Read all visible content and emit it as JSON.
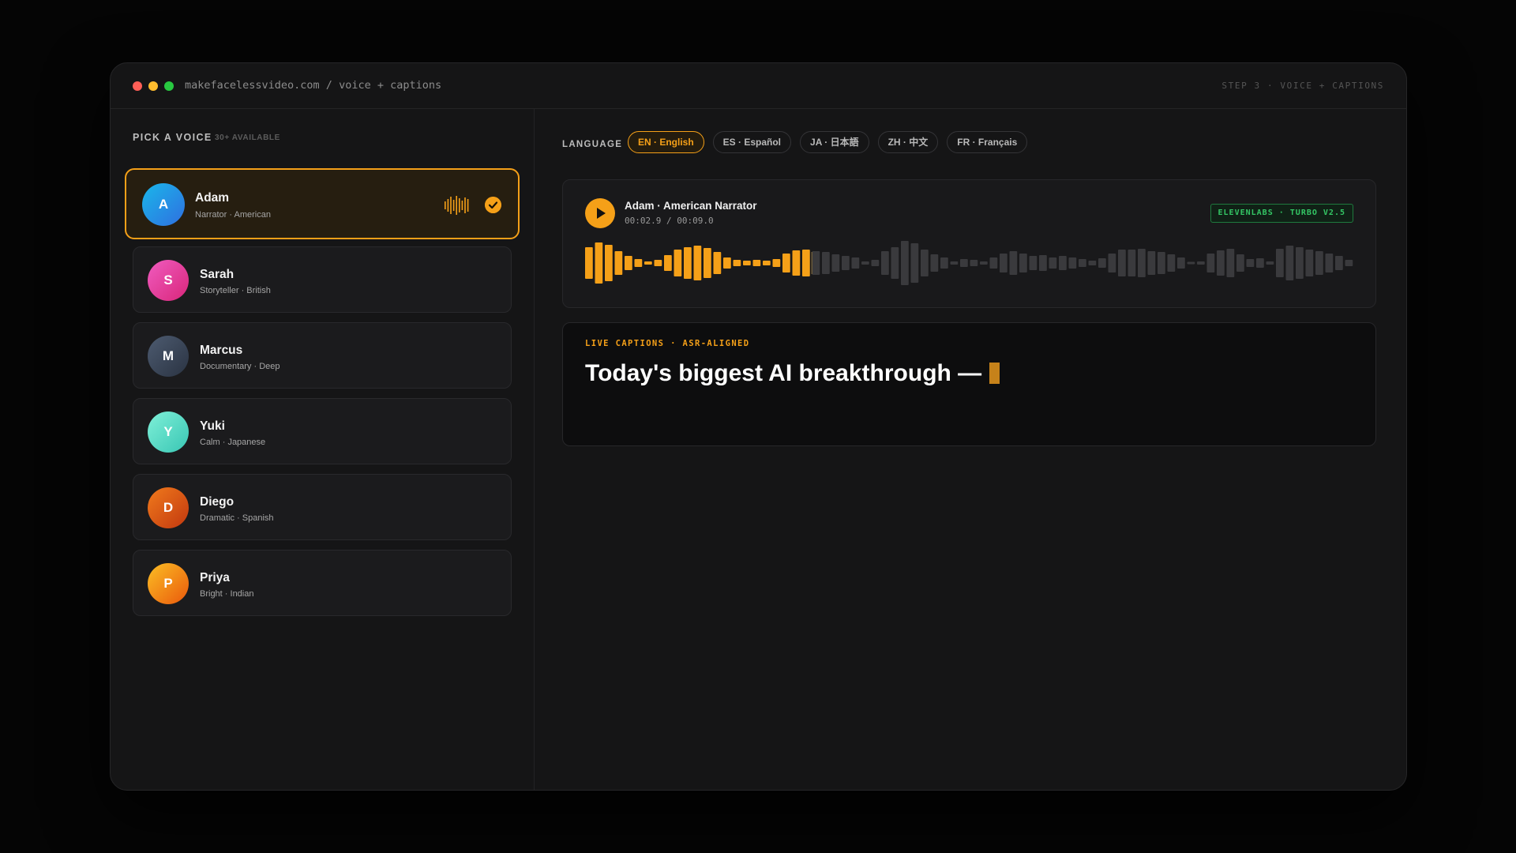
{
  "window": {
    "url": "makefacelessvideo.com / voice + captions",
    "step": "STEP 3 · VOICE + CAPTIONS"
  },
  "voices": {
    "title": "PICK A VOICE",
    "subtitle": "30+ AVAILABLE",
    "items": [
      {
        "initial": "A",
        "name": "Adam",
        "desc": "Narrator · American",
        "selected": true,
        "gradient": [
          "#1ab7ea",
          "#2f6fe0"
        ]
      },
      {
        "initial": "S",
        "name": "Sarah",
        "desc": "Storyteller · British",
        "selected": false,
        "gradient": [
          "#f05cc0",
          "#d9267a"
        ]
      },
      {
        "initial": "M",
        "name": "Marcus",
        "desc": "Documentary · Deep",
        "selected": false,
        "gradient": [
          "#4d5b70",
          "#2a3342"
        ]
      },
      {
        "initial": "Y",
        "name": "Yuki",
        "desc": "Calm · Japanese",
        "selected": false,
        "gradient": [
          "#7ff0d8",
          "#39c6b4"
        ]
      },
      {
        "initial": "D",
        "name": "Diego",
        "desc": "Dramatic · Spanish",
        "selected": false,
        "gradient": [
          "#f07a1c",
          "#c2380f"
        ]
      },
      {
        "initial": "P",
        "name": "Priya",
        "desc": "Bright · Indian",
        "selected": false,
        "gradient": [
          "#fbbf24",
          "#ea580c"
        ]
      }
    ]
  },
  "language": {
    "label": "LANGUAGE",
    "options": [
      "EN · English",
      "ES · Español",
      "JA · 日本語",
      "ZH · 中文",
      "FR · Français"
    ],
    "selected_index": 0
  },
  "player": {
    "title": "Adam · American Narrator",
    "time": "00:02.9 / 00:09.0",
    "engine": "ELEVENLABS · TURBO V2.5",
    "progress": 0.29
  },
  "captions": {
    "label": "LIVE CAPTIONS · ASR-ALIGNED",
    "text": "Today's biggest AI breakthrough —"
  },
  "colors": {
    "accent": "#f5a018",
    "wave_played": "#f5a018",
    "wave_unplayed": "#3a3a3d",
    "engine_green": "#34c765"
  }
}
